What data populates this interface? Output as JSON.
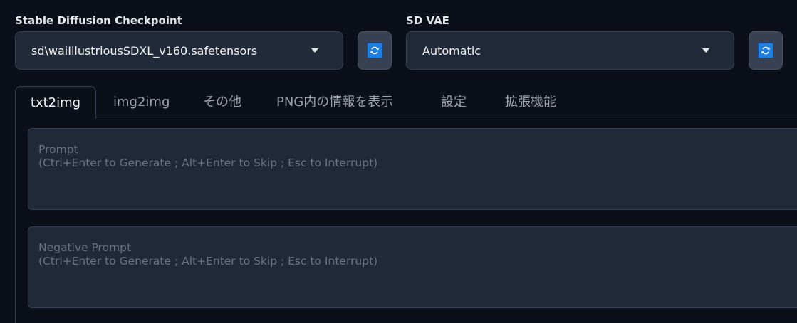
{
  "checkpoint": {
    "label": "Stable Diffusion Checkpoint",
    "value": "sd\\waiIllustriousSDXL_v160.safetensors"
  },
  "vae": {
    "label": "SD VAE",
    "value": "Automatic"
  },
  "tabs": [
    {
      "label": "txt2img",
      "active": true
    },
    {
      "label": "img2img"
    },
    {
      "label": "その他"
    },
    {
      "label": "PNG内の情報を表示"
    },
    {
      "label": "設定"
    },
    {
      "label": "拡張機能"
    }
  ],
  "prompt": {
    "placeholder_line1": "Prompt",
    "placeholder_line2": "(Ctrl+Enter to Generate ; Alt+Enter to Skip ; Esc to Interrupt)"
  },
  "negative_prompt": {
    "placeholder_line1": "Negative Prompt",
    "placeholder_line2": "(Ctrl+Enter to Generate ; Alt+Enter to Skip ; Esc to Interrupt)"
  },
  "icons": {
    "refresh": "refresh-icon",
    "dropdown": "chevron-down-icon"
  },
  "colors": {
    "background": "#0b0f19",
    "input_bg": "#1f2937",
    "refresh_icon": "#1d7fe0"
  }
}
